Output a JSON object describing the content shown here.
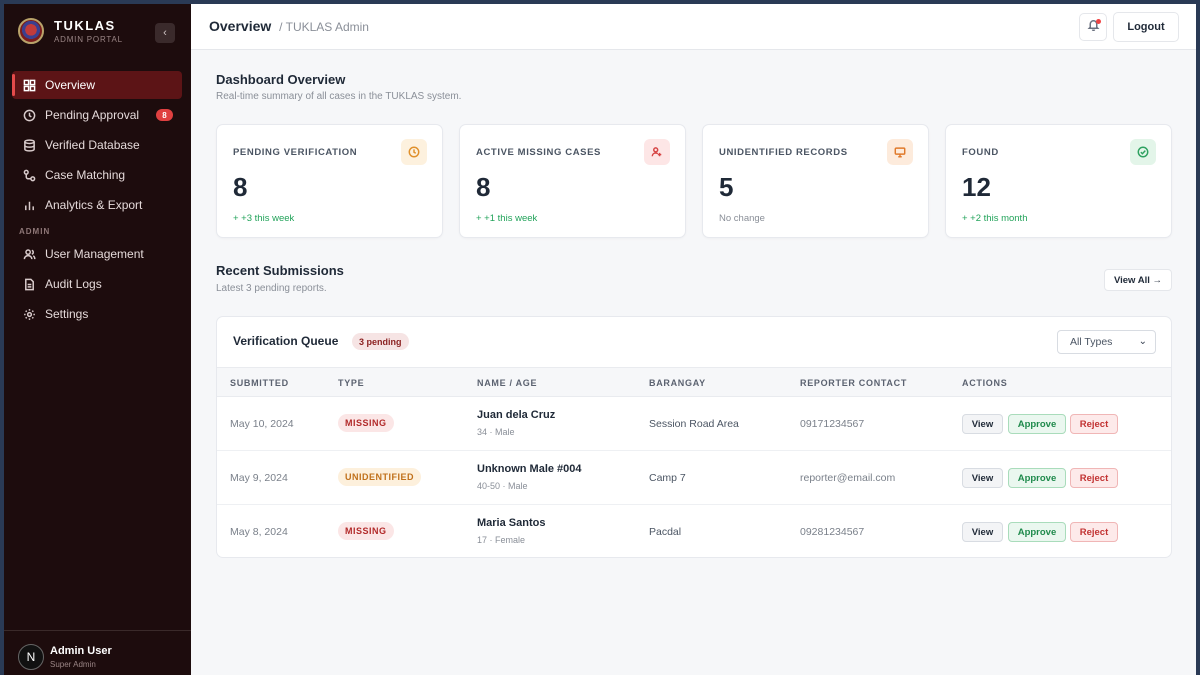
{
  "app": {
    "title": "TUKLAS",
    "subtitle": "ADMIN PORTAL"
  },
  "sidebar": {
    "collapse_icon": "chevron-left-icon",
    "items": [
      {
        "label": "Overview",
        "icon": "grid-icon",
        "active": true
      },
      {
        "label": "Pending Approval",
        "icon": "clock-icon",
        "badge": "8"
      },
      {
        "label": "Verified Database",
        "icon": "database-icon"
      },
      {
        "label": "Case Matching",
        "icon": "match-icon"
      },
      {
        "label": "Analytics & Export",
        "icon": "bar-chart-icon"
      }
    ],
    "admin_section": "ADMIN",
    "admin_items": [
      {
        "label": "User Management",
        "icon": "users-icon"
      },
      {
        "label": "Audit Logs",
        "icon": "file-icon"
      },
      {
        "label": "Settings",
        "icon": "gear-icon"
      }
    ],
    "user": {
      "initial": "N",
      "name": "Admin User",
      "role": "Super Admin"
    }
  },
  "header": {
    "title": "Overview",
    "crumb": "/ TUKLAS Admin",
    "logout_label": "Logout"
  },
  "dashboard": {
    "title": "Dashboard Overview",
    "subtitle": "Real-time summary of all cases in the TUKLAS system."
  },
  "stats": [
    {
      "label": "PENDING VERIFICATION",
      "value": "8",
      "note": "+ +3 this week",
      "icon": "clock-icon",
      "tone": "amber"
    },
    {
      "label": "ACTIVE MISSING CASES",
      "value": "8",
      "note": "+ +1 this week",
      "icon": "user-search-icon",
      "tone": "red"
    },
    {
      "label": "UNIDENTIFIED RECORDS",
      "value": "5",
      "note": "No change",
      "icon": "monitor-icon",
      "tone": "orange"
    },
    {
      "label": "FOUND",
      "value": "12",
      "note": "+ +2 this month",
      "icon": "check-circle-icon",
      "tone": "green"
    }
  ],
  "recent": {
    "title": "Recent Submissions",
    "subtitle": "Latest 3 pending reports.",
    "view_all": "View All →"
  },
  "queue": {
    "title": "Verification Queue",
    "badge": "3 pending",
    "filter": "All Types",
    "columns": [
      "SUBMITTED",
      "TYPE",
      "NAME / AGE",
      "BARANGAY",
      "REPORTER CONTACT",
      "ACTIONS"
    ],
    "rows": [
      {
        "submitted": "May 10, 2024",
        "type": "MISSING",
        "name": "Juan dela Cruz",
        "meta": "34 · Male",
        "barangay": "Session Road Area",
        "contact": "09171234567"
      },
      {
        "submitted": "May 9, 2024",
        "type": "UNIDENTIFIED",
        "name": "Unknown Male #004",
        "meta": "40-50 · Male",
        "barangay": "Camp 7",
        "contact": "reporter@email.com"
      },
      {
        "submitted": "May 8, 2024",
        "type": "MISSING",
        "name": "Maria Santos",
        "meta": "17 · Female",
        "barangay": "Pacdal",
        "contact": "09281234567"
      }
    ],
    "actions": {
      "view": "View",
      "approve": "Approve",
      "reject": "Reject"
    }
  }
}
